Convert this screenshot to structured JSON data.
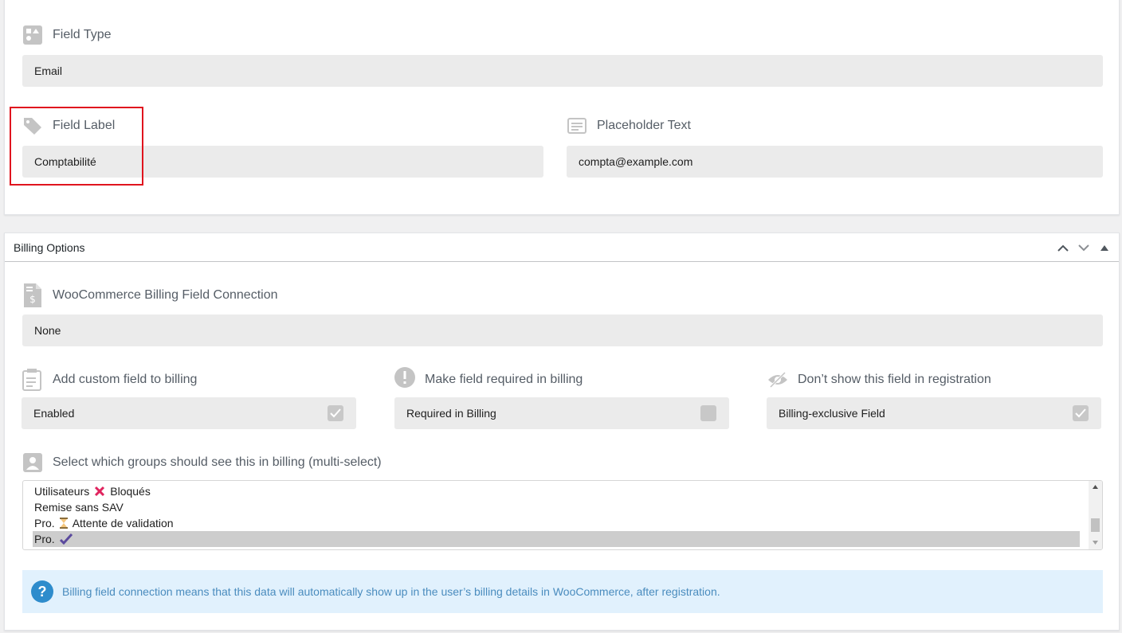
{
  "field_type": {
    "label": "Field Type",
    "value": "Email",
    "icon": "shapes-icon"
  },
  "field_label": {
    "label": "Field Label",
    "value": "Comptabilité",
    "icon": "tag-icon"
  },
  "placeholder_text": {
    "label": "Placeholder Text",
    "value": "compta@example.com",
    "icon": "text-lines-icon"
  },
  "billing_panel": {
    "title": "Billing Options",
    "connection": {
      "label": "WooCommerce Billing Field Connection",
      "value": "None",
      "icon": "invoice-icon"
    },
    "add_custom": {
      "label": "Add custom field to billing",
      "value": "Enabled",
      "checked": true,
      "icon": "clipboard-icon"
    },
    "required": {
      "label": "Make field required in billing",
      "value": "Required in Billing",
      "checked": false,
      "icon": "exclamation-icon"
    },
    "hide_registration": {
      "label": "Don’t show this field in registration",
      "value": "Billing-exclusive Field",
      "checked": true,
      "icon": "eye-slash-icon"
    },
    "groups": {
      "label": "Select which groups should see this in billing (multi-select)",
      "icon": "user-card-icon",
      "options": [
        {
          "before": "Utilisateurs",
          "emoji": "cross-mark",
          "after": "Bloqués",
          "selected": false
        },
        {
          "before": "Remise sans SAV",
          "emoji": "",
          "after": "",
          "selected": false
        },
        {
          "before": "Pro.",
          "emoji": "hourglass",
          "after": "Attente de validation",
          "selected": false
        },
        {
          "before": "Pro.",
          "emoji": "check-mark",
          "after": "",
          "selected": true
        }
      ]
    },
    "notice": "Billing field connection means that this data will automatically show up in the user’s billing details in WooCommerce, after registration."
  },
  "colors": {
    "highlight": "#e0141e",
    "notice_bg": "#e1f1fd",
    "notice_icon": "#2e8ccc",
    "notice_text": "#4a8cbe"
  }
}
